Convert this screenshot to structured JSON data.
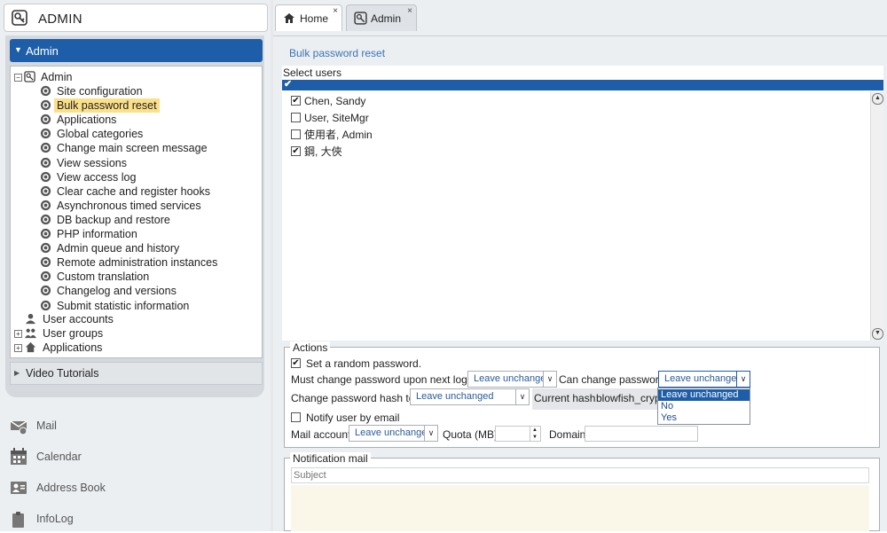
{
  "app": {
    "title": "ADMIN"
  },
  "tabs": [
    {
      "label": "Home",
      "close": "×"
    },
    {
      "label": "Admin",
      "close": "×"
    }
  ],
  "sidebar": {
    "section": "Admin",
    "tree_root": "Admin",
    "tree_items": [
      "Site configuration",
      "Bulk password reset",
      "Applications",
      "Global categories",
      "Change main screen message",
      "View sessions",
      "View access log",
      "Clear cache and register hooks",
      "Asynchronous timed services",
      "DB backup and restore",
      "PHP information",
      "Admin queue and history",
      "Remote administration instances",
      "Custom translation",
      "Changelog and versions",
      "Submit statistic information"
    ],
    "selected_item": "Bulk password reset",
    "top_items": [
      "User accounts",
      "User groups",
      "Applications"
    ],
    "video_section": "Video Tutorials",
    "nav": [
      "Mail",
      "Calendar",
      "Address Book",
      "InfoLog"
    ]
  },
  "main": {
    "breadcrumb": "Bulk password reset",
    "select_users_label": "Select users",
    "header_check": "✔",
    "users": [
      {
        "name": "Chen, Sandy",
        "checked": true
      },
      {
        "name": "User, SiteMgr",
        "checked": false
      },
      {
        "name": "使用者, Admin",
        "checked": false
      },
      {
        "name": "鋼, 大俠",
        "checked": true
      }
    ]
  },
  "actions": {
    "legend": "Actions",
    "random_password": {
      "label": "Set a random password.",
      "checked": true
    },
    "must_change_label": "Must change password upon next login",
    "must_change_value": "Leave unchanged",
    "can_change_label": "Can change password",
    "can_change_value": "Leave unchanged",
    "can_change_options": [
      "Leave unchanged",
      "No",
      "Yes"
    ],
    "hash_label": "Change password hash to",
    "hash_value": "Leave unchanged",
    "current_hash_label": "Current hash",
    "current_hash_value": "blowfish_cryp",
    "notify_label": "Notify user by email",
    "notify_checked": false,
    "mail_account_label": "Mail account",
    "mail_account_value": "Leave unchanged",
    "quota_label": "Quota (MB)",
    "domain_label": "Domain"
  },
  "notification": {
    "legend": "Notification mail",
    "subject_placeholder": "Subject"
  },
  "colors": {
    "accent": "#1e5ea8",
    "highlight": "#fbe08a",
    "link": "#3a74b5"
  }
}
